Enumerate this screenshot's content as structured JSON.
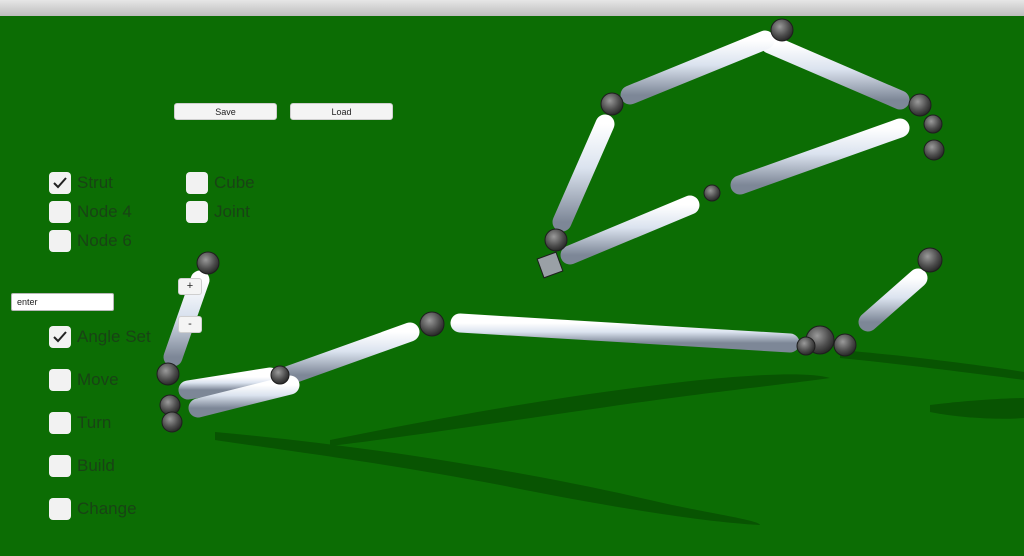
{
  "toolbar": {
    "save_label": "Save",
    "load_label": "Load"
  },
  "node_toggles": [
    {
      "label": "Strut",
      "checked": true
    },
    {
      "label": "Node 4",
      "checked": false
    },
    {
      "label": "Node 6",
      "checked": false
    },
    {
      "label": "Cube",
      "checked": false
    },
    {
      "label": "Joint",
      "checked": false
    }
  ],
  "angle_input": {
    "value": "enter"
  },
  "stepper": {
    "plus_label": "+",
    "minus_label": "-"
  },
  "mode_toggles": [
    {
      "label": "Angle Set",
      "checked": true
    },
    {
      "label": "Move",
      "checked": false
    },
    {
      "label": "Turn",
      "checked": false
    },
    {
      "label": "Build",
      "checked": false
    },
    {
      "label": "Change",
      "checked": false
    }
  ],
  "colors": {
    "ground": "#0c6d04",
    "strut": "#cfd8e6",
    "joint": "#4a4a4a"
  }
}
